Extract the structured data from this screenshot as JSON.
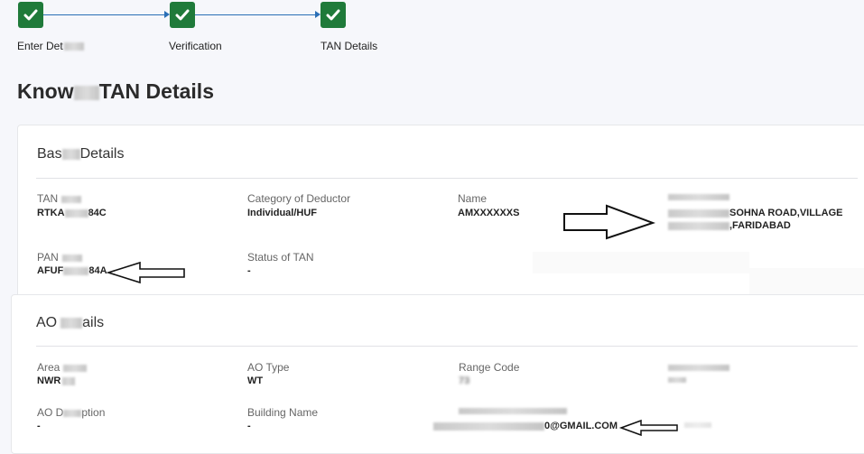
{
  "stepper": {
    "steps": [
      {
        "label": "Enter Det",
        "state": "complete"
      },
      {
        "label": "Verification",
        "state": "complete"
      },
      {
        "label": "TAN Details",
        "state": "complete"
      }
    ]
  },
  "page": {
    "title_part1": "Know",
    "title_part2": "TAN Details"
  },
  "basic_details": {
    "title_part1": "Bas",
    "title_part2": "Details",
    "fields": {
      "tan": {
        "label": "TAN",
        "value_part1": "RTKA",
        "value_part2": "84C"
      },
      "category": {
        "label": "Category of Deductor",
        "value": "Individual/HUF"
      },
      "name": {
        "label": "Name",
        "value": "AMXXXXXXS"
      },
      "address": {
        "line1": "SOHNA ROAD,VILLAGE",
        "line2": ",FARIDABAD"
      },
      "pan": {
        "label": "PAN",
        "value_part1": "AFUF",
        "value_part2": "84A"
      },
      "status": {
        "label": "Status of TAN",
        "value": "-"
      }
    }
  },
  "ao_details": {
    "title_part1": "AO",
    "title_part2": "ails",
    "fields": {
      "area": {
        "label": "Area",
        "value": "NWR"
      },
      "ao_type": {
        "label": "AO Type",
        "value": "WT"
      },
      "range_code": {
        "label": "Range Code",
        "value": "73"
      },
      "ao_description": {
        "label_part1": "AO D",
        "label_part2": "ption",
        "value": "-"
      },
      "building": {
        "label": "Building Name",
        "value": "-"
      },
      "email": {
        "value": "0@GMAIL.COM"
      }
    }
  },
  "colors": {
    "step_complete": "#1f7a3a",
    "step_line": "#2a6fb6"
  },
  "icons": {
    "step": "check-icon",
    "annotation": "outline-arrow-icon"
  }
}
